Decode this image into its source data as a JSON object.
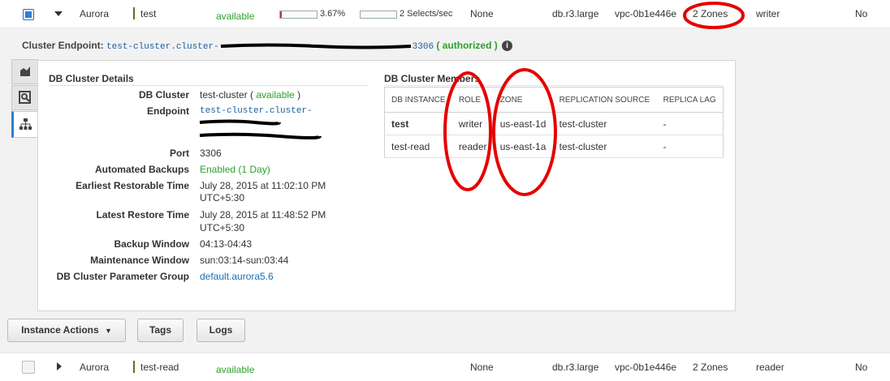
{
  "top_row": {
    "engine": "Aurora",
    "name": "test",
    "status": "available",
    "cpu_percent": "3.67%",
    "cpu_fraction": 0.0367,
    "connections": "2 Selects/sec",
    "replication": "None",
    "instance_class": "db.r3.large",
    "vpc": "vpc-0b1e446e",
    "multi_az": "2 Zones",
    "role": "writer",
    "encrypted": "No"
  },
  "endpoint": {
    "label": "Cluster Endpoint:",
    "value_start": "test-cluster.cluster-",
    "value_end": "3306",
    "open_paren": "(",
    "status": "authorized",
    "close_paren": ")"
  },
  "side_tabs": [
    {
      "icon": "monitoring-chart-icon"
    },
    {
      "icon": "magnifier-icon"
    },
    {
      "icon": "sitemap-icon"
    }
  ],
  "details": {
    "title": "DB Cluster Details",
    "db_cluster_label": "DB Cluster",
    "db_cluster_value": "test-cluster (",
    "db_cluster_status": "available",
    "db_cluster_close": ")",
    "endpoint_label": "Endpoint",
    "endpoint_value": "test-cluster.cluster-",
    "port_label": "Port",
    "port_value": "3306",
    "backups_label": "Automated Backups",
    "backups_value": "Enabled (1 Day)",
    "earliest_label": "Earliest Restorable Time",
    "earliest_line1": "July 28, 2015 at 11:02:10 PM",
    "earliest_line2": "UTC+5:30",
    "latest_label": "Latest Restore Time",
    "latest_line1": "July 28, 2015 at 11:48:52 PM",
    "latest_line2": "UTC+5:30",
    "backup_window_label": "Backup Window",
    "backup_window_value": "04:13-04:43",
    "maint_label": "Maintenance Window",
    "maint_value": "sun:03:14-sun:03:44",
    "param_label": "DB Cluster Parameter Group",
    "param_value": "default.aurora5.6"
  },
  "members": {
    "title": "DB Cluster Members",
    "columns": [
      "DB INSTANCE",
      "ROLE",
      "ZONE",
      "REPLICATION SOURCE",
      "REPLICA LAG"
    ],
    "rows": [
      {
        "instance": "test",
        "role": "writer",
        "zone": "us-east-1d",
        "source": "test-cluster",
        "lag": "-"
      },
      {
        "instance": "test-read",
        "role": "reader",
        "zone": "us-east-1a",
        "source": "test-cluster",
        "lag": "-"
      }
    ]
  },
  "buttons": {
    "instance_actions": "Instance Actions",
    "tags": "Tags",
    "logs": "Logs"
  },
  "bottom_row": {
    "engine": "Aurora",
    "name": "test-read",
    "status": "available",
    "replication": "None",
    "instance_class": "db.r3.large",
    "vpc": "vpc-0b1e446e",
    "multi_az": "2 Zones",
    "role": "reader",
    "encrypted": "No"
  },
  "colors": {
    "accent": "#2f7ed8",
    "status_green": "#2ba12b",
    "annotation_red": "#e60000"
  }
}
